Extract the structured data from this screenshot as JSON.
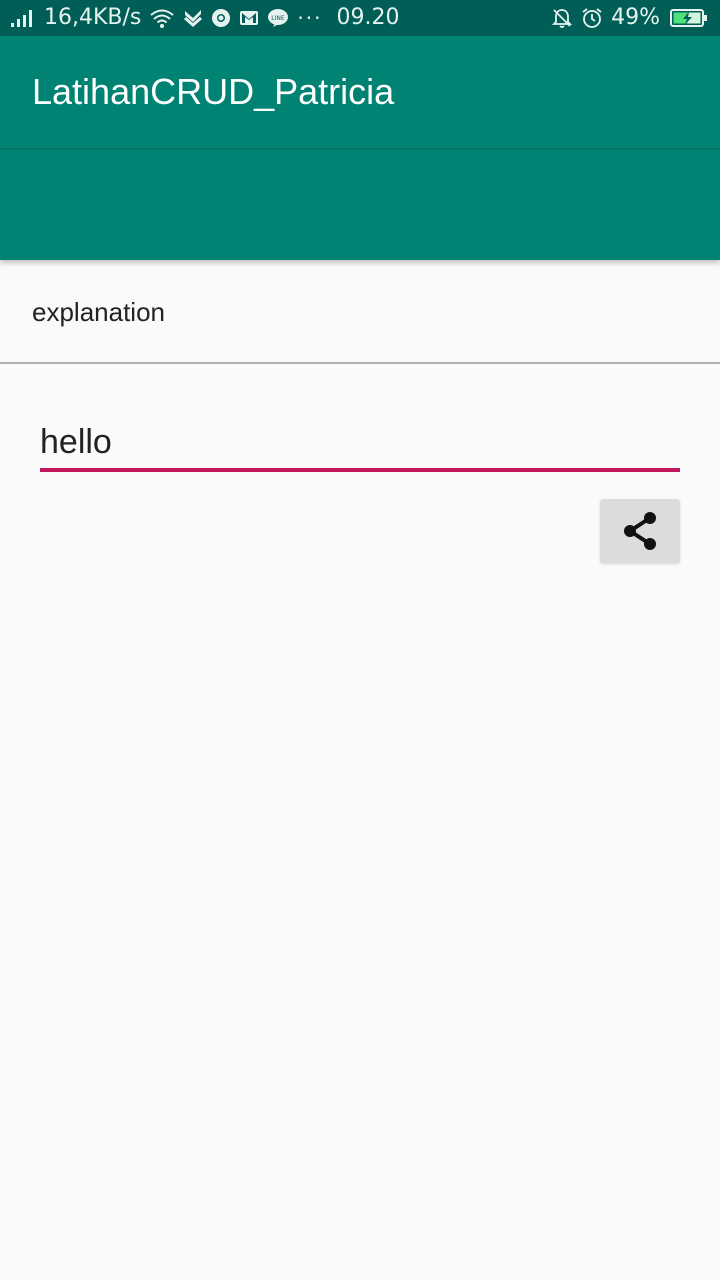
{
  "status_bar": {
    "network_speed": "16,4KB/s",
    "overflow": "···",
    "time": "09.20",
    "battery_percent": "49%",
    "icons": [
      "signal-icon",
      "wifi-icon",
      "check-notification-icon",
      "chrome-icon",
      "gmail-icon",
      "line-icon",
      "mute-notification-icon",
      "alarm-icon",
      "battery-charging-icon"
    ]
  },
  "app_bar": {
    "title": "LatihanCRUD_Patricia",
    "color": "#018374"
  },
  "content": {
    "label": "explanation",
    "input_value": "hello",
    "input_underline_color": "#c2185b",
    "share_icon": "share-icon"
  }
}
